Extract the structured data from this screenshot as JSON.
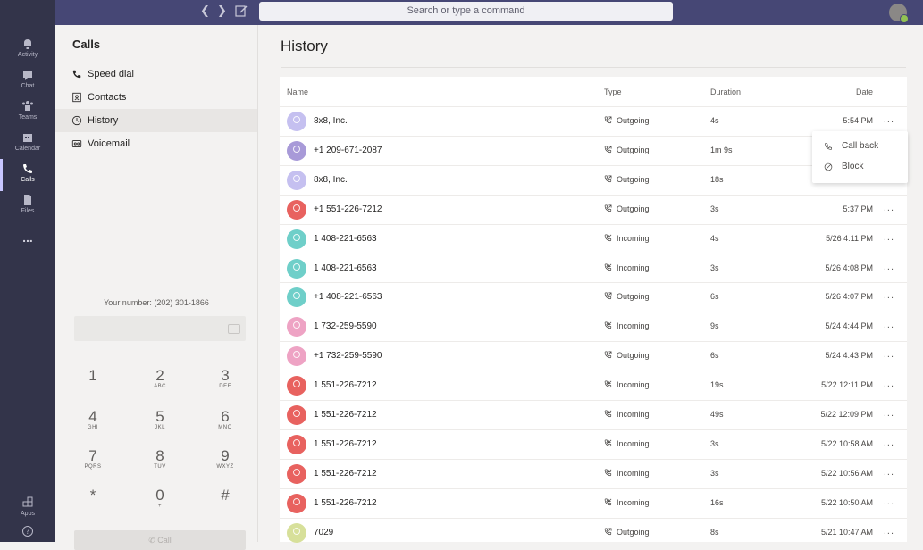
{
  "topbar": {
    "search_placeholder": "Search or type a command"
  },
  "rail": {
    "items": [
      {
        "label": "Activity",
        "icon": "bell-icon"
      },
      {
        "label": "Chat",
        "icon": "chat-icon"
      },
      {
        "label": "Teams",
        "icon": "teams-icon"
      },
      {
        "label": "Calendar",
        "icon": "calendar-icon"
      },
      {
        "label": "Calls",
        "icon": "phone-icon",
        "active": true
      },
      {
        "label": "Files",
        "icon": "file-icon"
      },
      {
        "label": "...",
        "icon": "more-icon"
      }
    ],
    "apps_label": "Apps",
    "help_label": ""
  },
  "left": {
    "title": "Calls",
    "nav": [
      {
        "label": "Speed dial",
        "icon": "phone-icon"
      },
      {
        "label": "Contacts",
        "icon": "contacts-icon"
      },
      {
        "label": "History",
        "icon": "clock-icon",
        "active": true
      },
      {
        "label": "Voicemail",
        "icon": "voicemail-icon"
      }
    ],
    "your_number": "Your number: (202) 301-1866",
    "keys": [
      {
        "d": "1",
        "l": ""
      },
      {
        "d": "2",
        "l": "ABC"
      },
      {
        "d": "3",
        "l": "DEF"
      },
      {
        "d": "4",
        "l": "GHI"
      },
      {
        "d": "5",
        "l": "JKL"
      },
      {
        "d": "6",
        "l": "MNO"
      },
      {
        "d": "7",
        "l": "PQRS"
      },
      {
        "d": "8",
        "l": "TUV"
      },
      {
        "d": "9",
        "l": "WXYZ"
      },
      {
        "d": "*",
        "l": ""
      },
      {
        "d": "0",
        "l": "+"
      },
      {
        "d": "#",
        "l": ""
      }
    ],
    "call_label": "Call"
  },
  "main": {
    "title": "History",
    "columns": {
      "name": "Name",
      "type": "Type",
      "duration": "Duration",
      "date": "Date"
    },
    "rows": [
      {
        "name": "8x8, Inc.",
        "type": "Outgoing",
        "duration": "4s",
        "date": "5:54 PM",
        "color": "#c5c0f0"
      },
      {
        "name": "+1 209-671-2087",
        "type": "Outgoing",
        "duration": "1m 9s",
        "date": "",
        "color": "#a89ad8"
      },
      {
        "name": "8x8, Inc.",
        "type": "Outgoing",
        "duration": "18s",
        "date": "",
        "color": "#c5c0f0"
      },
      {
        "name": "+1 551-226-7212",
        "type": "Outgoing",
        "duration": "3s",
        "date": "5:37 PM",
        "color": "#e8625f"
      },
      {
        "name": "1 408-221-6563",
        "type": "Incoming",
        "duration": "4s",
        "date": "5/26 4:11 PM",
        "color": "#6fcfc9"
      },
      {
        "name": "1 408-221-6563",
        "type": "Incoming",
        "duration": "3s",
        "date": "5/26 4:08 PM",
        "color": "#6fcfc9"
      },
      {
        "name": "+1 408-221-6563",
        "type": "Outgoing",
        "duration": "6s",
        "date": "5/26 4:07 PM",
        "color": "#6fcfc9"
      },
      {
        "name": "1 732-259-5590",
        "type": "Incoming",
        "duration": "9s",
        "date": "5/24 4:44 PM",
        "color": "#eea3c4"
      },
      {
        "name": "+1 732-259-5590",
        "type": "Outgoing",
        "duration": "6s",
        "date": "5/24 4:43 PM",
        "color": "#eea3c4"
      },
      {
        "name": "1 551-226-7212",
        "type": "Incoming",
        "duration": "19s",
        "date": "5/22 12:11 PM",
        "color": "#e8625f"
      },
      {
        "name": "1 551-226-7212",
        "type": "Incoming",
        "duration": "49s",
        "date": "5/22 12:09 PM",
        "color": "#e8625f"
      },
      {
        "name": "1 551-226-7212",
        "type": "Incoming",
        "duration": "3s",
        "date": "5/22 10:58 AM",
        "color": "#e8625f"
      },
      {
        "name": "1 551-226-7212",
        "type": "Incoming",
        "duration": "3s",
        "date": "5/22 10:56 AM",
        "color": "#e8625f"
      },
      {
        "name": "1 551-226-7212",
        "type": "Incoming",
        "duration": "16s",
        "date": "5/22 10:50 AM",
        "color": "#e8625f"
      },
      {
        "name": "7029",
        "type": "Outgoing",
        "duration": "8s",
        "date": "5/21 10:47 AM",
        "color": "#d7e09a"
      }
    ],
    "more_label": "..."
  },
  "context_menu": {
    "items": [
      {
        "label": "Call back",
        "icon": "phone-icon"
      },
      {
        "label": "Block",
        "icon": "block-icon"
      }
    ]
  }
}
